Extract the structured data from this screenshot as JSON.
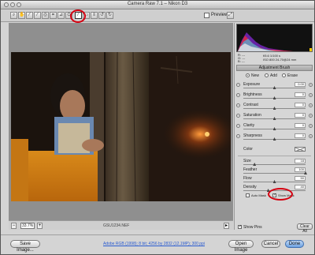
{
  "window": {
    "title": "Camera Raw 7.1 – Nikon D3"
  },
  "toolbar": {
    "tools": [
      "zoom-icon",
      "hand-icon",
      "white-balance-icon",
      "color-sampler-icon",
      "target-adjustment-icon",
      "crop-icon",
      "straighten-icon",
      "spot-removal-icon",
      "red-eye-icon",
      "adjustment-brush-icon",
      "graduated-filter-icon",
      "preferences-icon",
      "rotate-left-icon",
      "rotate-right-icon"
    ],
    "preview_label": "Preview"
  },
  "status": {
    "zoom": "33.7%",
    "filename": "GSU1234.NEF"
  },
  "info": {
    "r": "R: ---",
    "g": "G: ---",
    "b": "B: ---",
    "exposure": "f/5.6   1/100 s",
    "iso": "ISO 800   24-70@24 mm"
  },
  "panel": {
    "header": "Adjustment Brush",
    "mode_new": "New",
    "mode_add": "Add",
    "mode_erase": "Erase",
    "color_label": "Color",
    "auto_mask": "Auto Mask",
    "show_mask": "Show Mask",
    "show_pins": "Show Pins",
    "clear_all": "Clear All"
  },
  "sliders_top": [
    {
      "name": "Exposure",
      "value": "0.00"
    },
    {
      "name": "Brightness",
      "value": "0"
    },
    {
      "name": "Contrast",
      "value": "0"
    },
    {
      "name": "Saturation",
      "value": "0"
    },
    {
      "name": "Clarity",
      "value": "0"
    },
    {
      "name": "Sharpness",
      "value": "0"
    }
  ],
  "sliders_bottom": [
    {
      "name": "Size",
      "value": "18"
    },
    {
      "name": "Feather",
      "value": "100"
    },
    {
      "name": "Flow",
      "value": "50"
    },
    {
      "name": "Density",
      "value": "40"
    }
  ],
  "footer": {
    "save": "Save Image...",
    "workflow": "Adobe RGB (1998); 8 bit; 4256 by 2832 (12.1MP); 300 ppi",
    "open": "Open Image",
    "cancel": "Cancel",
    "done": "Done"
  },
  "colors": {
    "annotation": "#d40010"
  }
}
